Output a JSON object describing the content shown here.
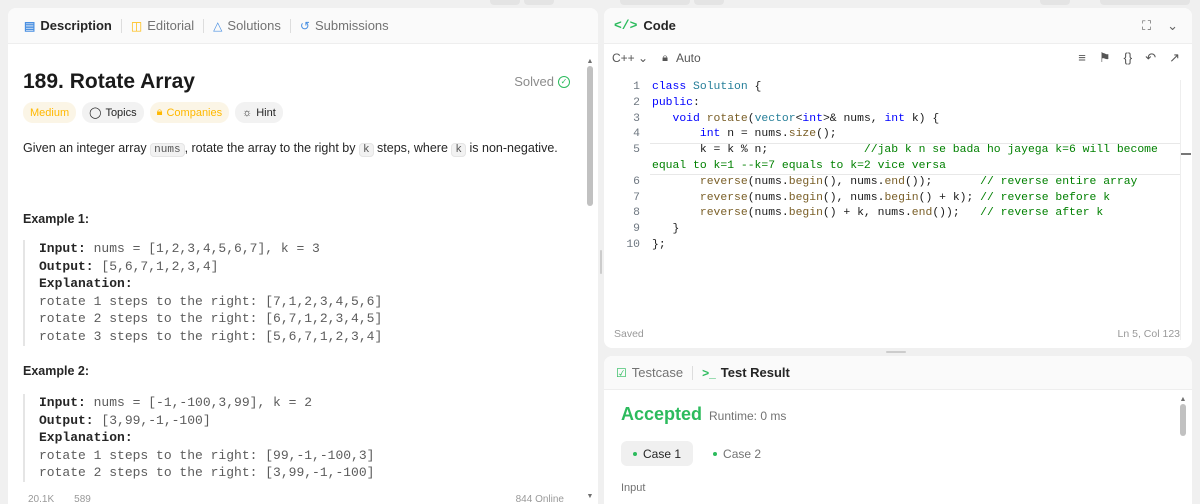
{
  "left_tabs": {
    "description": "Description",
    "editorial": "Editorial",
    "solutions": "Solutions",
    "submissions": "Submissions"
  },
  "problem": {
    "title": "189. Rotate Array",
    "status": "Solved",
    "tags": {
      "difficulty": "Medium",
      "topics": "Topics",
      "companies": "Companies",
      "hint": "Hint"
    },
    "desc_1": "Given an integer array ",
    "desc_nums": "nums",
    "desc_2": ", rotate the array to the right by ",
    "desc_k1": "k",
    "desc_3": " steps, where ",
    "desc_k2": "k",
    "desc_4": " is non-negative."
  },
  "examples": [
    {
      "heading": "Example 1:",
      "input_label": "Input:",
      "input": " nums = [1,2,3,4,5,6,7], k = 3",
      "output_label": "Output:",
      "output": " [5,6,7,1,2,3,4]",
      "explanation_label": "Explanation:",
      "lines": [
        "rotate 1 steps to the right: [7,1,2,3,4,5,6]",
        "rotate 2 steps to the right: [6,7,1,2,3,4,5]",
        "rotate 3 steps to the right: [5,6,7,1,2,3,4]"
      ]
    },
    {
      "heading": "Example 2:",
      "input_label": "Input:",
      "input": " nums = [-1,-100,3,99], k = 2",
      "output_label": "Output:",
      "output": " [3,99,-1,-100]",
      "explanation_label": "Explanation:",
      "lines": [
        "rotate 1 steps to the right: [99,-1,-100,3]",
        "rotate 2 steps to the right: [3,99,-1,-100]"
      ]
    }
  ],
  "footer": {
    "likes": "20.1K",
    "comments": "589",
    "online": "844 Online"
  },
  "code_panel": {
    "title": "Code",
    "language": "C++",
    "mode": "Auto",
    "saved": "Saved",
    "position": "Ln 5, Col 123",
    "line_numbers": [
      "1",
      "2",
      "3",
      "4",
      "5",
      "",
      "6",
      "7",
      "8",
      "9",
      "10"
    ]
  },
  "test_panel": {
    "testcase": "Testcase",
    "result": "Test Result",
    "verdict": "Accepted",
    "runtime": "Runtime: 0 ms",
    "case1": "Case 1",
    "case2": "Case 2",
    "input_label": "Input"
  },
  "colors": {
    "accent_green": "#2cbb5d",
    "medium": "#ffb800"
  }
}
